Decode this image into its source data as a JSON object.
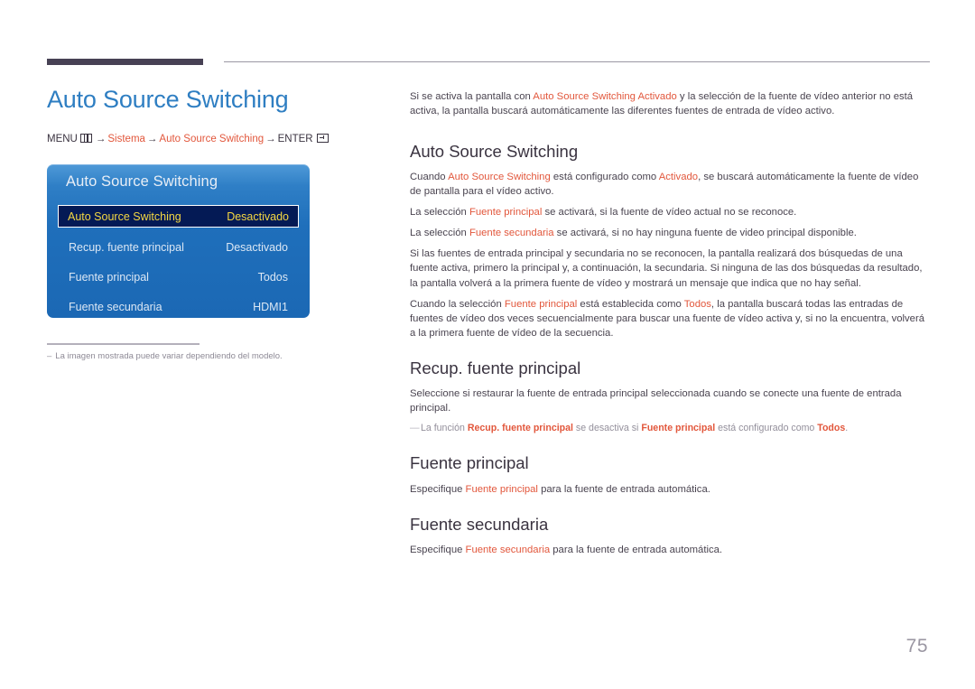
{
  "header": {
    "rule_thick": true,
    "rule_thin": true
  },
  "left": {
    "page_title": "Auto Source Switching",
    "breadcrumb": {
      "menu_label": "MENU",
      "menu_icon": "menu-grid-icon",
      "arrow": "→",
      "step1": "Sistema",
      "step2": "Auto Source Switching",
      "enter_label": "ENTER",
      "enter_icon": "enter-key-icon"
    },
    "osd": {
      "title": "Auto Source Switching",
      "rows": [
        {
          "label": "Auto Source Switching",
          "value": "Desactivado",
          "selected": true
        },
        {
          "label": "Recup. fuente principal",
          "value": "Desactivado",
          "selected": false
        },
        {
          "label": "Fuente principal",
          "value": "Todos",
          "selected": false
        },
        {
          "label": "Fuente secundaria",
          "value": "HDMI1",
          "selected": false
        }
      ]
    },
    "footnote": {
      "dash": "–",
      "text": "La imagen mostrada puede variar dependiendo del modelo."
    }
  },
  "right": {
    "intro": {
      "p1_a": "Si se activa la pantalla con ",
      "p1_r1": "Auto Source Switching Activado",
      "p1_b": " y la selección de la fuente de vídeo anterior no está activa, la pantalla buscará automáticamente las diferentes fuentes de entrada de vídeo activo."
    },
    "sections": [
      {
        "heading": "Auto Source Switching",
        "paragraphs": [
          {
            "a": "Cuando ",
            "r1": "Auto Source Switching",
            "b": " está configurado como ",
            "r2": "Activado",
            "c": ", se buscará automáticamente la fuente de vídeo de pantalla para el vídeo activo."
          },
          {
            "a": "La selección ",
            "r1": "Fuente principal",
            "b": " se activará, si la fuente de vídeo actual no se reconoce.",
            "r2": "",
            "c": ""
          },
          {
            "a": "La selección ",
            "r1": "Fuente secundaria",
            "b": " se activará, si no hay ninguna fuente de video principal disponible.",
            "r2": "",
            "c": ""
          },
          {
            "a": "Si las fuentes de entrada principal y secundaria no se reconocen, la pantalla realizará dos búsquedas de una fuente activa, primero la principal y, a continuación, la secundaria. Si ninguna de las dos búsquedas da resultado, la pantalla volverá a la primera fuente de vídeo y mostrará un mensaje que indica que no hay señal.",
            "r1": "",
            "b": "",
            "r2": "",
            "c": ""
          },
          {
            "a": "Cuando la selección ",
            "r1": "Fuente principal",
            "b": " está establecida como ",
            "r2": "Todos",
            "c": ", la pantalla buscará todas las entradas de fuentes de vídeo dos veces secuencialmente para buscar una fuente de vídeo activa y, si no la encuentra, volverá a la primera fuente de vídeo de la secuencia."
          }
        ]
      },
      {
        "heading": "Recup. fuente principal",
        "paragraphs": [
          {
            "a": "Seleccione si restaurar la fuente de entrada principal seleccionada cuando se conecte una fuente de entrada principal.",
            "r1": "",
            "b": "",
            "r2": "",
            "c": ""
          }
        ],
        "note": {
          "dash": "—",
          "a": "La función ",
          "r1": "Recup. fuente principal",
          "b": " se desactiva si ",
          "r2": "Fuente principal",
          "c": " está configurado como ",
          "r3": "Todos",
          "d": "."
        }
      },
      {
        "heading": "Fuente principal",
        "paragraphs": [
          {
            "a": "Especifique ",
            "r1": "Fuente principal",
            "b": " para la fuente de entrada automática.",
            "r2": "",
            "c": ""
          }
        ]
      },
      {
        "heading": "Fuente secundaria",
        "paragraphs": [
          {
            "a": "Especifique ",
            "r1": "Fuente secundaria",
            "b": " para la fuente de entrada automática.",
            "r2": "",
            "c": ""
          }
        ]
      }
    ]
  },
  "page_number": "75",
  "colors": {
    "title_blue": "#2e7ec2",
    "accent_red": "#e2573c",
    "heading_dark": "#3a3340",
    "body_gray": "#4a4450",
    "note_gray": "#938f9b",
    "osd_blue": "#1f6fbb",
    "osd_selected_bg": "#041a55",
    "osd_selected_text": "#f5d842",
    "rule_dark": "#474154"
  }
}
